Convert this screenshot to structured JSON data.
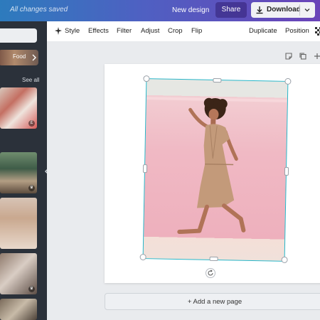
{
  "topbar": {
    "saved_status": "All changes saved",
    "new_design": "New design",
    "share": "Share",
    "download": "Download",
    "icons": [
      "download-icon",
      "chevron-down-icon"
    ]
  },
  "sidebar": {
    "category_pill": "Food",
    "see_all": "See all"
  },
  "toolbar": {
    "items": [
      "Style",
      "Effects",
      "Filter",
      "Adjust",
      "Crop",
      "Flip",
      "Duplicate",
      "Position"
    ]
  },
  "canvas": {
    "add_page": "+ Add a new page"
  },
  "colors": {
    "topbar_start": "#2d7bbd",
    "topbar_end": "#6a43b8",
    "selection": "#27b5c7",
    "sidebar_bg": "#2b313a",
    "photo_bg": "#f0b9c4"
  }
}
